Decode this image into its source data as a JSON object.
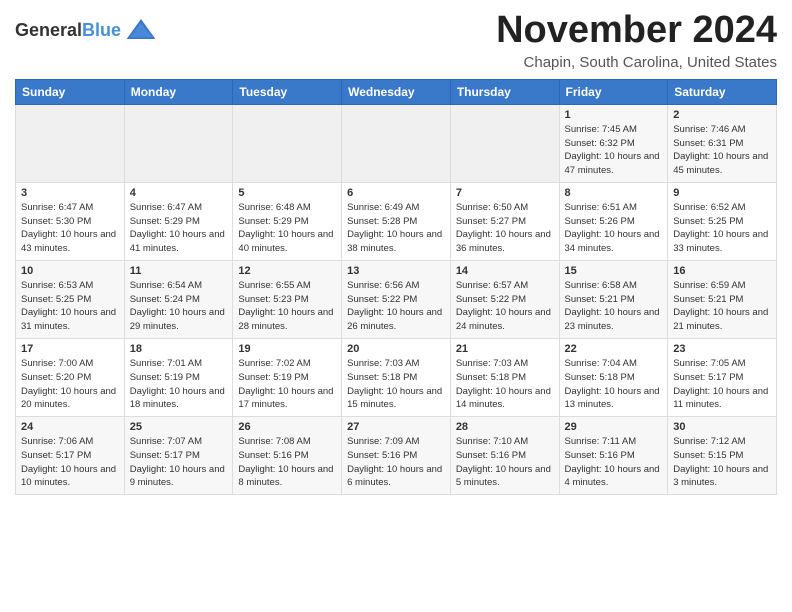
{
  "header": {
    "logo_line1": "General",
    "logo_line2": "Blue",
    "month": "November 2024",
    "location": "Chapin, South Carolina, United States"
  },
  "weekdays": [
    "Sunday",
    "Monday",
    "Tuesday",
    "Wednesday",
    "Thursday",
    "Friday",
    "Saturday"
  ],
  "weeks": [
    [
      {
        "day": "",
        "empty": true
      },
      {
        "day": "",
        "empty": true
      },
      {
        "day": "",
        "empty": true
      },
      {
        "day": "",
        "empty": true
      },
      {
        "day": "",
        "empty": true
      },
      {
        "day": "1",
        "sunrise": "7:45 AM",
        "sunset": "6:32 PM",
        "daylight": "10 hours and 47 minutes."
      },
      {
        "day": "2",
        "sunrise": "7:46 AM",
        "sunset": "6:31 PM",
        "daylight": "10 hours and 45 minutes."
      }
    ],
    [
      {
        "day": "3",
        "sunrise": "6:47 AM",
        "sunset": "5:30 PM",
        "daylight": "10 hours and 43 minutes."
      },
      {
        "day": "4",
        "sunrise": "6:47 AM",
        "sunset": "5:29 PM",
        "daylight": "10 hours and 41 minutes."
      },
      {
        "day": "5",
        "sunrise": "6:48 AM",
        "sunset": "5:29 PM",
        "daylight": "10 hours and 40 minutes."
      },
      {
        "day": "6",
        "sunrise": "6:49 AM",
        "sunset": "5:28 PM",
        "daylight": "10 hours and 38 minutes."
      },
      {
        "day": "7",
        "sunrise": "6:50 AM",
        "sunset": "5:27 PM",
        "daylight": "10 hours and 36 minutes."
      },
      {
        "day": "8",
        "sunrise": "6:51 AM",
        "sunset": "5:26 PM",
        "daylight": "10 hours and 34 minutes."
      },
      {
        "day": "9",
        "sunrise": "6:52 AM",
        "sunset": "5:25 PM",
        "daylight": "10 hours and 33 minutes."
      }
    ],
    [
      {
        "day": "10",
        "sunrise": "6:53 AM",
        "sunset": "5:25 PM",
        "daylight": "10 hours and 31 minutes."
      },
      {
        "day": "11",
        "sunrise": "6:54 AM",
        "sunset": "5:24 PM",
        "daylight": "10 hours and 29 minutes."
      },
      {
        "day": "12",
        "sunrise": "6:55 AM",
        "sunset": "5:23 PM",
        "daylight": "10 hours and 28 minutes."
      },
      {
        "day": "13",
        "sunrise": "6:56 AM",
        "sunset": "5:22 PM",
        "daylight": "10 hours and 26 minutes."
      },
      {
        "day": "14",
        "sunrise": "6:57 AM",
        "sunset": "5:22 PM",
        "daylight": "10 hours and 24 minutes."
      },
      {
        "day": "15",
        "sunrise": "6:58 AM",
        "sunset": "5:21 PM",
        "daylight": "10 hours and 23 minutes."
      },
      {
        "day": "16",
        "sunrise": "6:59 AM",
        "sunset": "5:21 PM",
        "daylight": "10 hours and 21 minutes."
      }
    ],
    [
      {
        "day": "17",
        "sunrise": "7:00 AM",
        "sunset": "5:20 PM",
        "daylight": "10 hours and 20 minutes."
      },
      {
        "day": "18",
        "sunrise": "7:01 AM",
        "sunset": "5:19 PM",
        "daylight": "10 hours and 18 minutes."
      },
      {
        "day": "19",
        "sunrise": "7:02 AM",
        "sunset": "5:19 PM",
        "daylight": "10 hours and 17 minutes."
      },
      {
        "day": "20",
        "sunrise": "7:03 AM",
        "sunset": "5:18 PM",
        "daylight": "10 hours and 15 minutes."
      },
      {
        "day": "21",
        "sunrise": "7:03 AM",
        "sunset": "5:18 PM",
        "daylight": "10 hours and 14 minutes."
      },
      {
        "day": "22",
        "sunrise": "7:04 AM",
        "sunset": "5:18 PM",
        "daylight": "10 hours and 13 minutes."
      },
      {
        "day": "23",
        "sunrise": "7:05 AM",
        "sunset": "5:17 PM",
        "daylight": "10 hours and 11 minutes."
      }
    ],
    [
      {
        "day": "24",
        "sunrise": "7:06 AM",
        "sunset": "5:17 PM",
        "daylight": "10 hours and 10 minutes."
      },
      {
        "day": "25",
        "sunrise": "7:07 AM",
        "sunset": "5:17 PM",
        "daylight": "10 hours and 9 minutes."
      },
      {
        "day": "26",
        "sunrise": "7:08 AM",
        "sunset": "5:16 PM",
        "daylight": "10 hours and 8 minutes."
      },
      {
        "day": "27",
        "sunrise": "7:09 AM",
        "sunset": "5:16 PM",
        "daylight": "10 hours and 6 minutes."
      },
      {
        "day": "28",
        "sunrise": "7:10 AM",
        "sunset": "5:16 PM",
        "daylight": "10 hours and 5 minutes."
      },
      {
        "day": "29",
        "sunrise": "7:11 AM",
        "sunset": "5:16 PM",
        "daylight": "10 hours and 4 minutes."
      },
      {
        "day": "30",
        "sunrise": "7:12 AM",
        "sunset": "5:15 PM",
        "daylight": "10 hours and 3 minutes."
      }
    ]
  ]
}
